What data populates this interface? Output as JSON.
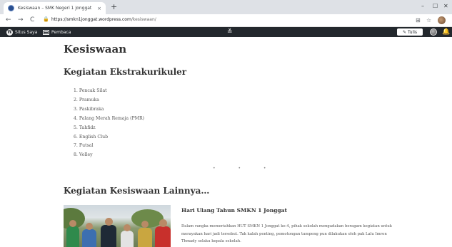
{
  "browser": {
    "tab_title": "Kesiswaan – SMK Negeri 1 Jonggat",
    "tab_close": "×",
    "new_tab": "+",
    "minimize": "–",
    "maximize": "☐",
    "close": "✕",
    "back": "←",
    "forward": "→",
    "reload": "C",
    "url_host": "https://smkn1jonggat.wordpress.com",
    "url_path": "/kesiswaan/",
    "translate_icon": "⊞",
    "star_icon": "☆"
  },
  "adminbar": {
    "my_site": "Situs Saya",
    "reader": "Pembaca",
    "center_icon": "≚",
    "write": "Tulis",
    "bell_icon": "🔔"
  },
  "page": {
    "title": "Kesiswaan",
    "section1_heading": "Kegiatan Ekstrakurikuler",
    "activities": [
      "1. Pencak Silat",
      "2. Pramuka",
      "3. Paskibraka",
      "4. Palang Merah Remaja (PMR)",
      "5. Tahfidz",
      "6. English Club",
      "7. Futsal",
      "8. Volley"
    ],
    "loader": "• • •",
    "section2_heading": "Kegiatan Kesiswaan Lainnya…"
  },
  "post": {
    "title": "Hari Ulang Tahun SMKN 1 Jonggat",
    "excerpt": "Dalam rangka memeriahkan HUT SMKN 1 Jonggat ke-4, pihak sekolah mengadakan beragam kegiatan untuk merayakan hari jadi tersebut. Tak kalah penting, pemotongan tumpeng pun dilakukan oleh pak Lalu Imron Thmady selaku kepala sekolah."
  },
  "colors": {
    "adminbar_bg": "#23282d",
    "tabbar_bg": "#dee1e6",
    "heading_text": "#333333"
  }
}
